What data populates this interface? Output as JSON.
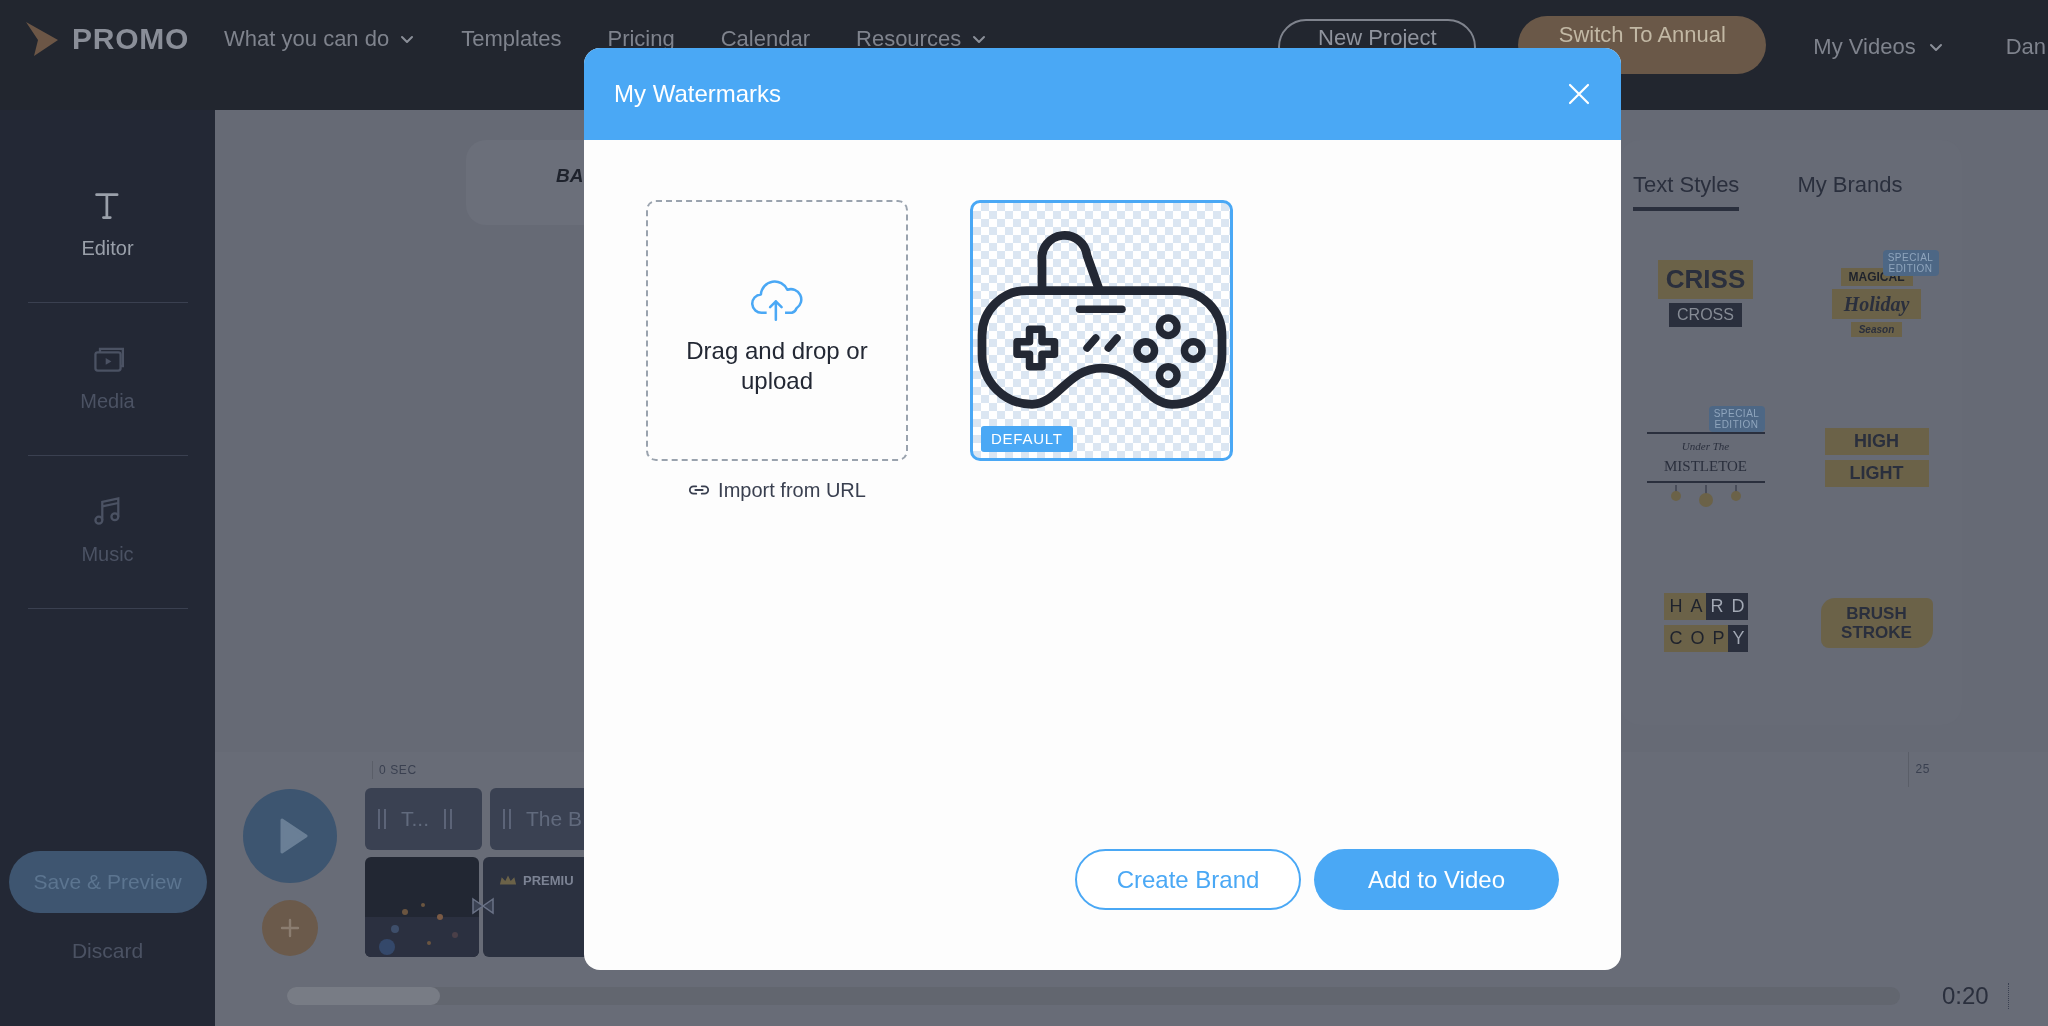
{
  "header": {
    "logo": "PROMO",
    "nav": [
      {
        "label": "What you can do",
        "dropdown": true
      },
      {
        "label": "Templates",
        "dropdown": false
      },
      {
        "label": "Pricing",
        "dropdown": false
      },
      {
        "label": "Calendar",
        "dropdown": false
      },
      {
        "label": "Resources",
        "dropdown": true
      }
    ],
    "new_project": "New Project",
    "switch_plan": "Switch To Annual",
    "my_videos": "My Videos",
    "user": "Dan"
  },
  "sidebar": {
    "items": [
      {
        "label": "Editor",
        "selected": true
      },
      {
        "label": "Media",
        "selected": false
      },
      {
        "label": "Music",
        "selected": false
      }
    ],
    "save": "Save & Preview",
    "discard": "Discard"
  },
  "canvas": {
    "text": "BA"
  },
  "styles_panel": {
    "tabs": [
      {
        "label": "Text Styles",
        "selected": true
      },
      {
        "label": "My Brands",
        "selected": false
      }
    ],
    "styles": [
      {
        "kind": "criss_cross",
        "lines": [
          "CRISS",
          "CROSS"
        ]
      },
      {
        "kind": "holiday",
        "badge": "SPECIAL EDITION",
        "lines": [
          "MAGICAL",
          "Holiday",
          "Season"
        ]
      },
      {
        "kind": "mistletoe",
        "badge": "SPECIAL EDITION",
        "lines": [
          "Under The",
          "MISTLETOE"
        ]
      },
      {
        "kind": "highlight",
        "lines": [
          "HIGH",
          "LIGHT"
        ]
      },
      {
        "kind": "hard_copy",
        "lines": [
          "HARD",
          "COPY"
        ]
      },
      {
        "kind": "brush",
        "lines": [
          "BRUSH",
          "STROKE"
        ]
      }
    ]
  },
  "timeline": {
    "ruler": [
      "0 SEC",
      "25"
    ],
    "text_clips": [
      "T...",
      "The B"
    ],
    "media_clips": [
      {
        "kind": "video"
      },
      {
        "kind": "premium",
        "label": "PREMIU"
      }
    ],
    "time": "0:20"
  },
  "modal": {
    "title": "My Watermarks",
    "upload_text": "Drag and drop or upload",
    "import_link": "Import from URL",
    "watermarks": [
      {
        "badge": "DEFAULT",
        "selected": true
      }
    ],
    "buttons": [
      {
        "label": "Create Brand",
        "kind": "outline"
      },
      {
        "label": "Add to Video",
        "kind": "primary"
      }
    ]
  }
}
